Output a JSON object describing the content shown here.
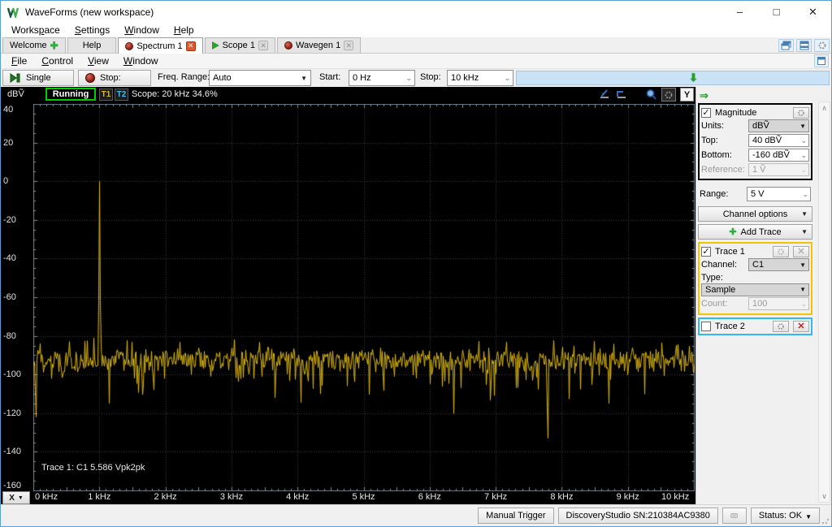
{
  "window": {
    "title": "WaveForms (new workspace)",
    "controls": {
      "minimize": "–",
      "maximize": "□",
      "close": "✕"
    }
  },
  "menubar": {
    "main": [
      {
        "label": "Workspace",
        "mnemonic": 5
      },
      {
        "label": "Settings",
        "mnemonic": 0
      },
      {
        "label": "Window",
        "mnemonic": 0
      },
      {
        "label": "Help",
        "mnemonic": 0
      }
    ],
    "document": [
      {
        "label": "File",
        "mnemonic": 0
      },
      {
        "label": "Control",
        "mnemonic": 0
      },
      {
        "label": "View",
        "mnemonic": 0
      },
      {
        "label": "Window",
        "mnemonic": 0
      }
    ]
  },
  "tabs": [
    {
      "label": "Welcome",
      "icon": "add"
    },
    {
      "label": "Help",
      "icon": "none"
    },
    {
      "label": "Spectrum 1",
      "icon": "instrument-dot",
      "active": true,
      "closable": true
    },
    {
      "label": "Scope 1",
      "icon": "play",
      "closable": true
    },
    {
      "label": "Wavegen 1",
      "icon": "instrument-dot",
      "closable": true
    }
  ],
  "toolbar": {
    "single_label": "Single",
    "stop_label": "Stop:",
    "freq_range_label": "Freq. Range:",
    "freq_range_value": "Auto",
    "start_label": "Start:",
    "start_value": "0 Hz",
    "stop_value": "10 kHz"
  },
  "plot": {
    "unit_label": "dBṼ",
    "run_status": "Running",
    "t1_label": "T1",
    "t2_label": "T2",
    "scope_info": "Scope: 20 kHz 34.6%",
    "trace_info": "Trace 1: C1 5.586 Vpk2pk",
    "x_button_label": "X",
    "y_ticks": [
      "40",
      "20",
      "0",
      "-20",
      "-40",
      "-60",
      "-80",
      "-100",
      "-120",
      "-140",
      "-160"
    ],
    "x_ticks": [
      "0 kHz",
      "1 kHz",
      "2 kHz",
      "3 kHz",
      "4 kHz",
      "5 kHz",
      "6 kHz",
      "7 kHz",
      "8 kHz",
      "9 kHz",
      "10 kHz"
    ]
  },
  "chart_data": {
    "type": "line",
    "title": "Spectrum 1 magnitude trace",
    "x_unit": "kHz",
    "y_unit": "dBV",
    "x_range_khz": [
      0,
      10
    ],
    "y_range_dbv": [
      40,
      -160
    ],
    "x_tick_labels": [
      "0 kHz",
      "1 kHz",
      "2 kHz",
      "3 kHz",
      "4 kHz",
      "5 kHz",
      "6 kHz",
      "7 kHz",
      "8 kHz",
      "9 kHz",
      "10 kHz"
    ],
    "y_tick_labels": [
      40,
      20,
      0,
      -20,
      -40,
      -60,
      -80,
      -100,
      -120,
      -140,
      -160
    ],
    "grid": "dotted",
    "background": "#000000",
    "series": [
      {
        "name": "Trace 1",
        "channel": "C1",
        "color": "#ddb90f",
        "acquisition_type": "Sample",
        "measurement": "Trace 1: C1 5.586 Vpk2pk",
        "main_peak": {
          "freq_khz": 1.0,
          "level_dbv": 0
        },
        "noise_floor": {
          "mean_dbv": -91,
          "spread_dbv": 9,
          "typical_range_dbv": [
            -105,
            -80
          ]
        },
        "notable_dips": [
          {
            "freq_khz": 0.04,
            "level_dbv": -122
          },
          {
            "freq_khz": 7.78,
            "level_dbv": -133
          }
        ],
        "noise_seed": 20
      }
    ]
  },
  "panel": {
    "magnitude": {
      "label": "Magnitude",
      "checked": true,
      "units_label": "Units:",
      "units_value": "dBṼ",
      "top_label": "Top:",
      "top_value": "40 dBṼ",
      "bottom_label": "Bottom:",
      "bottom_value": "-160 dBṼ",
      "reference_label": "Reference:",
      "reference_value": "1 Ṽ"
    },
    "range_label": "Range:",
    "range_value": "5 V",
    "channel_options_label": "Channel options",
    "add_trace_label": "Add Trace",
    "trace1": {
      "label": "Trace 1",
      "checked": true,
      "border_color": "#f5c400",
      "channel_label": "Channel:",
      "channel_value": "C1",
      "type_label": "Type:",
      "type_value": "Sample",
      "count_label": "Count:",
      "count_value": "100"
    },
    "trace2": {
      "label": "Trace 2",
      "checked": false,
      "border_color": "#2fb9ec"
    }
  },
  "statusbar": {
    "manual_trigger_label": "Manual Trigger",
    "device_label": "DiscoveryStudio SN:210384AC9380",
    "status_label": "Status: OK"
  },
  "colors": {
    "trace_yellow": "#ddb90f",
    "running_green": "#00cc00",
    "t1_yellow": "#e6b800",
    "t2_cyan": "#3ec1f0",
    "plot_background": "#000000",
    "grid_gray": "#3f3f3f",
    "drop_strip_blue": "#c9e2f5"
  }
}
